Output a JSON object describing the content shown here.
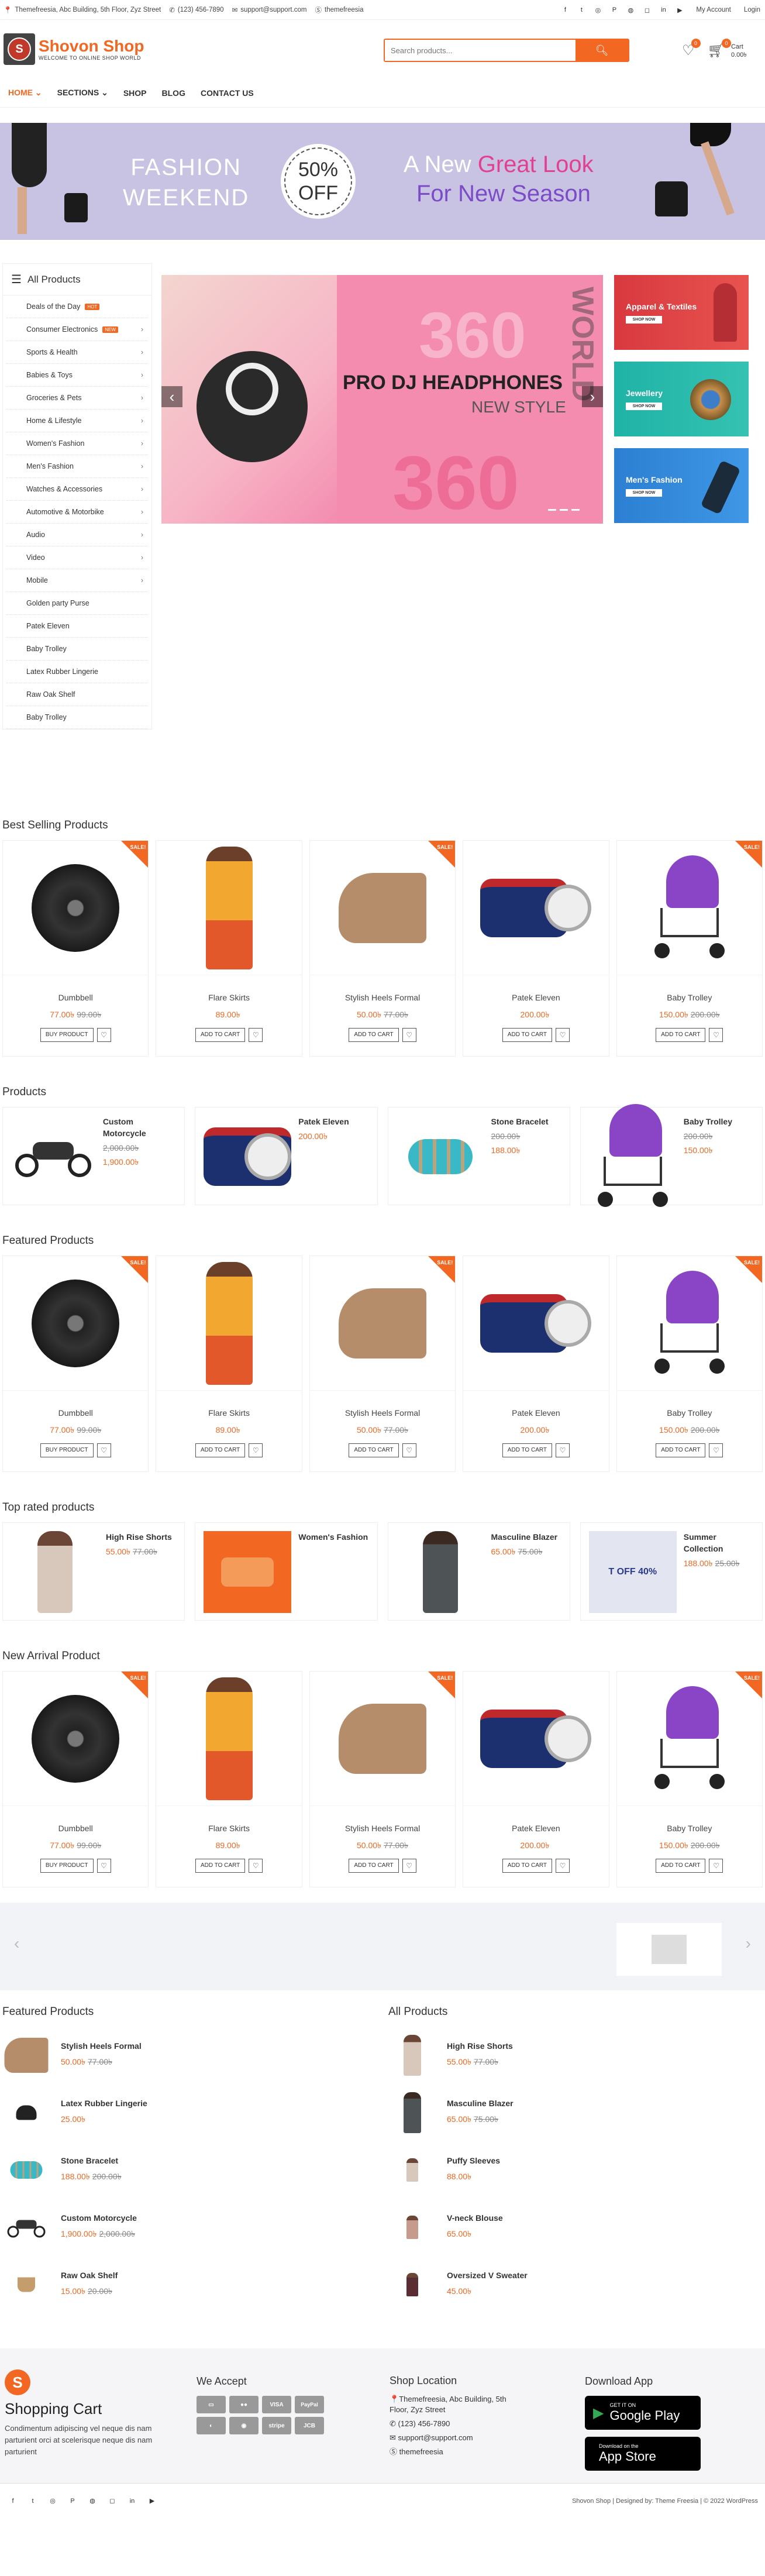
{
  "topbar": {
    "address": "Themefreesia, Abc Building, 5th Floor, Zyz Street",
    "phone": "(123) 456-7890",
    "email": "support@support.com",
    "skype": "themefreesia",
    "my_account": "My Account",
    "login": "Login"
  },
  "header": {
    "brand": "Shovon Shop",
    "tagline": "WELCOME TO ONLINE SHOP WORLD",
    "search_placeholder": "Search products...",
    "wishlist_count": "0",
    "cart_count": "0",
    "cart_label": "Cart",
    "cart_total": "0.00৳"
  },
  "nav": [
    "HOME",
    "SECTIONS",
    "SHOP",
    "BLOG",
    "CONTACT US"
  ],
  "banner": {
    "l1": "FASHION",
    "l2": "WEEKEND",
    "pct": "50%",
    "off": "OFF",
    "a_new": "A New",
    "great_look": "Great Look",
    "for_season": "For New Season"
  },
  "sidebar": {
    "title": "All Products",
    "items": [
      {
        "label": "Deals of the Day",
        "badge": "HOT",
        "arrow": false
      },
      {
        "label": "Consumer Electronics",
        "badge": "NEW",
        "arrow": true
      },
      {
        "label": "Sports & Health",
        "badge": "",
        "arrow": true
      },
      {
        "label": "Babies & Toys",
        "badge": "",
        "arrow": true
      },
      {
        "label": "Groceries & Pets",
        "badge": "",
        "arrow": true
      },
      {
        "label": "Home & Lifestyle",
        "badge": "",
        "arrow": true
      },
      {
        "label": "Women's Fashion",
        "badge": "",
        "arrow": true
      },
      {
        "label": "Men's Fashion",
        "badge": "",
        "arrow": true
      },
      {
        "label": "Watches & Accessories",
        "badge": "",
        "arrow": true
      },
      {
        "label": "Automotive & Motorbike",
        "badge": "",
        "arrow": true
      },
      {
        "label": "Audio",
        "badge": "",
        "arrow": true
      },
      {
        "label": "Video",
        "badge": "",
        "arrow": true
      },
      {
        "label": "Mobile",
        "badge": "",
        "arrow": true
      },
      {
        "label": "Golden party Purse",
        "badge": "",
        "arrow": false
      },
      {
        "label": "Patek Eleven",
        "badge": "",
        "arrow": false
      },
      {
        "label": "Baby Trolley",
        "badge": "",
        "arrow": false
      },
      {
        "label": "Latex Rubber Lingerie",
        "badge": "",
        "arrow": false
      },
      {
        "label": "Raw Oak Shelf",
        "badge": "",
        "arrow": false
      },
      {
        "label": "Baby Trolley",
        "badge": "",
        "arrow": false
      }
    ]
  },
  "slider": {
    "title": "PRO DJ HEADPHONES",
    "sub": "NEW STYLE",
    "big": "360",
    "vertical": "DIGITAL WORLD"
  },
  "ads": [
    {
      "label": "Apparel & Textiles",
      "btn": "SHOP NOW"
    },
    {
      "label": "Jewellery",
      "btn": "SHOP NOW"
    },
    {
      "label": "Men's Fashion",
      "btn": "SHOP NOW"
    }
  ],
  "sale_label": "SALE!",
  "best_selling": {
    "title": "Best Selling Products",
    "items": [
      {
        "name": "Dumbbell",
        "price": "77.00৳",
        "old": "99.00৳",
        "btn": "BUY PRODUCT",
        "sale": true
      },
      {
        "name": "Flare Skirts",
        "price": "89.00৳",
        "old": "",
        "btn": "ADD TO CART",
        "sale": false
      },
      {
        "name": "Stylish Heels Formal",
        "price": "50.00৳",
        "old": "77.00৳",
        "btn": "ADD TO CART",
        "sale": true
      },
      {
        "name": "Patek Eleven",
        "price": "200.00৳",
        "old": "",
        "btn": "ADD TO CART",
        "sale": false
      },
      {
        "name": "Baby Trolley",
        "price": "150.00৳",
        "old": "200.00৳",
        "btn": "ADD TO CART",
        "sale": true
      }
    ]
  },
  "products": {
    "title": "Products",
    "items": [
      {
        "name": "Custom Motorcycle",
        "old": "2,000.00৳",
        "price": "1,900.00৳"
      },
      {
        "name": "Patek Eleven",
        "old": "",
        "price": "200.00৳"
      },
      {
        "name": "Stone Bracelet",
        "old": "200.00৳",
        "price": "188.00৳"
      },
      {
        "name": "Baby Trolley",
        "old": "200.00৳",
        "price": "150.00৳"
      }
    ]
  },
  "featured": {
    "title": "Featured Products",
    "items": [
      {
        "name": "Dumbbell",
        "price": "77.00৳",
        "old": "99.00৳",
        "btn": "BUY PRODUCT",
        "sale": true
      },
      {
        "name": "Flare Skirts",
        "price": "89.00৳",
        "old": "",
        "btn": "ADD TO CART",
        "sale": false
      },
      {
        "name": "Stylish Heels Formal",
        "price": "50.00৳",
        "old": "77.00৳",
        "btn": "ADD TO CART",
        "sale": true
      },
      {
        "name": "Patek Eleven",
        "price": "200.00৳",
        "old": "",
        "btn": "ADD TO CART",
        "sale": false
      },
      {
        "name": "Baby Trolley",
        "price": "150.00৳",
        "old": "200.00৳",
        "btn": "ADD TO CART",
        "sale": true
      }
    ]
  },
  "top_rated": {
    "title": "Top rated products",
    "items": [
      {
        "name": "High Rise Shorts",
        "price": "55.00৳",
        "old": "77.00৳"
      },
      {
        "name": "Women's Fashion",
        "price": "",
        "old": ""
      },
      {
        "name": "Masculine Blazer",
        "price": "65.00৳",
        "old": "75.00৳"
      },
      {
        "name": "Summer Collection",
        "price": "188.00৳",
        "old": "25.00৳",
        "img_text": "T OFF 40%"
      }
    ]
  },
  "new_arrival": {
    "title": "New Arrival Product",
    "items": [
      {
        "name": "Dumbbell",
        "price": "77.00৳",
        "old": "99.00৳",
        "btn": "BUY PRODUCT",
        "sale": true
      },
      {
        "name": "Flare Skirts",
        "price": "89.00৳",
        "old": "",
        "btn": "ADD TO CART",
        "sale": false
      },
      {
        "name": "Stylish Heels Formal",
        "price": "50.00৳",
        "old": "77.00৳",
        "btn": "ADD TO CART",
        "sale": true
      },
      {
        "name": "Patek Eleven",
        "price": "200.00৳",
        "old": "",
        "btn": "ADD TO CART",
        "sale": false
      },
      {
        "name": "Baby Trolley",
        "price": "150.00৳",
        "old": "200.00৳",
        "btn": "ADD TO CART",
        "sale": true
      }
    ]
  },
  "featured_list": {
    "title": "Featured Products",
    "items": [
      {
        "name": "Stylish Heels Formal",
        "price": "50.00৳",
        "old": "77.00৳"
      },
      {
        "name": "Latex Rubber Lingerie",
        "price": "25.00৳",
        "old": ""
      },
      {
        "name": "Stone Bracelet",
        "price": "188.00৳",
        "old": "200.00৳"
      },
      {
        "name": "Custom Motorcycle",
        "price": "1,900.00৳",
        "old": "2,000.00৳"
      },
      {
        "name": "Raw Oak Shelf",
        "price": "15.00৳",
        "old": "20.00৳"
      }
    ]
  },
  "all_list": {
    "title": "All Products",
    "items": [
      {
        "name": "High Rise Shorts",
        "price": "55.00৳",
        "old": "77.00৳"
      },
      {
        "name": "Masculine Blazer",
        "price": "65.00৳",
        "old": "75.00৳"
      },
      {
        "name": "Puffy Sleeves",
        "price": "88.00৳",
        "old": ""
      },
      {
        "name": "V-neck Blouse",
        "price": "65.00৳",
        "old": ""
      },
      {
        "name": "Oversized V Sweater",
        "price": "45.00৳",
        "old": ""
      }
    ]
  },
  "footer": {
    "about_title": "Shopping Cart",
    "about_text": "Condimentum adipiscing vel neque dis nam parturient orci at scelerisque neque dis nam parturient",
    "accept_title": "We Accept",
    "cards": [
      "VISA",
      "PayPal",
      "stripe",
      "JCB"
    ],
    "location_title": "Shop Location",
    "loc_address": "Themefreesia, Abc Building, 5th Floor, Zyz Street",
    "loc_phone": "(123) 456-7890",
    "loc_email": "support@support.com",
    "loc_skype": "themefreesia",
    "app_title": "Download App",
    "gp_small": "GET IT ON",
    "gp_big": "Google Play",
    "as_small": "Download on the",
    "as_big": "App Store",
    "copyright": "Shovon Shop | Designed by: Theme Freesia | © 2022 WordPress"
  },
  "colors": {
    "accent": "#f26722",
    "banner": "#c9c3e3",
    "slider": "#f48cb0"
  }
}
